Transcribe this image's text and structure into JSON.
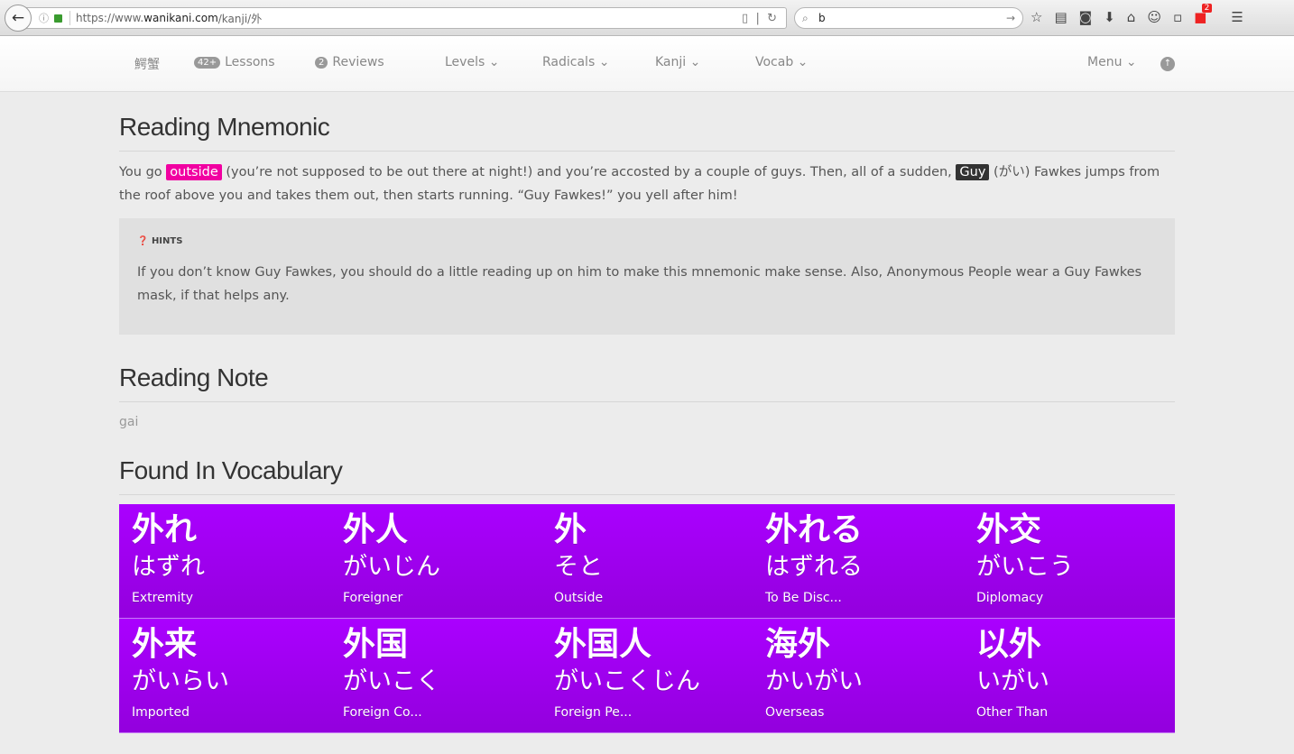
{
  "browser": {
    "url_prefix": "https://www.",
    "url_domain": "wanikani.com",
    "url_path": "/kanji/外",
    "search_value": "b",
    "notification_count": "2"
  },
  "nav": {
    "user": "鰐蟹",
    "lessons_count": "42+",
    "lessons": "Lessons",
    "reviews_count": "2",
    "reviews": "Reviews",
    "levels": "Levels",
    "radicals": "Radicals",
    "kanji": "Kanji",
    "vocab": "Vocab",
    "menu": "Menu"
  },
  "reading_mnemonic": {
    "title": "Reading Mnemonic",
    "t1": "You go ",
    "hl1": "outside",
    "t2": " (you’re not supposed to be out there at night!) and you’re accosted by a couple of guys. Then, all of a sudden, ",
    "hl2": "Guy",
    "t3": " (がい) Fawkes jumps from the roof above you and takes them out, then starts running. “Guy Fawkes!” you yell after him!",
    "hints_label": "HINTS",
    "hints_text": "If you don’t know Guy Fawkes, you should do a little reading up on him to make this mnemonic make sense. Also, Anonymous People wear a Guy Fawkes mask, if that helps any."
  },
  "reading_note": {
    "title": "Reading Note",
    "text": "gai"
  },
  "vocab": {
    "title": "Found In Vocabulary",
    "items": [
      {
        "characters": "外れ",
        "reading": "はずれ",
        "meaning": "Extremity"
      },
      {
        "characters": "外人",
        "reading": "がいじん",
        "meaning": "Foreigner"
      },
      {
        "characters": "外",
        "reading": "そと",
        "meaning": "Outside"
      },
      {
        "characters": "外れる",
        "reading": "はずれる",
        "meaning": "To Be Disc..."
      },
      {
        "characters": "外交",
        "reading": "がいこう",
        "meaning": "Diplomacy"
      },
      {
        "characters": "外来",
        "reading": "がいらい",
        "meaning": "Imported"
      },
      {
        "characters": "外国",
        "reading": "がいこく",
        "meaning": "Foreign Co..."
      },
      {
        "characters": "外国人",
        "reading": "がいこくじん",
        "meaning": "Foreign Pe..."
      },
      {
        "characters": "海外",
        "reading": "かいがい",
        "meaning": "Overseas"
      },
      {
        "characters": "以外",
        "reading": "いがい",
        "meaning": "Other Than"
      }
    ]
  }
}
